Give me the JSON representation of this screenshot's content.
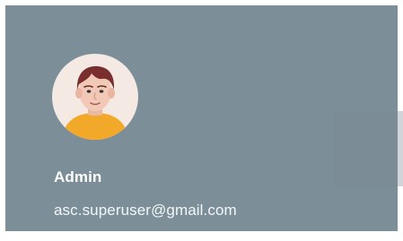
{
  "profile": {
    "avatar_icon": "male-user-avatar-icon",
    "name": "Admin",
    "email": "asc.superuser@gmail.com"
  },
  "colors": {
    "header_background": "#7c8f99",
    "avatar_background": "#f5e9e4",
    "shirt": "#f2a92a",
    "hair": "#7a2f2f",
    "skin": "#f2c9b6"
  }
}
